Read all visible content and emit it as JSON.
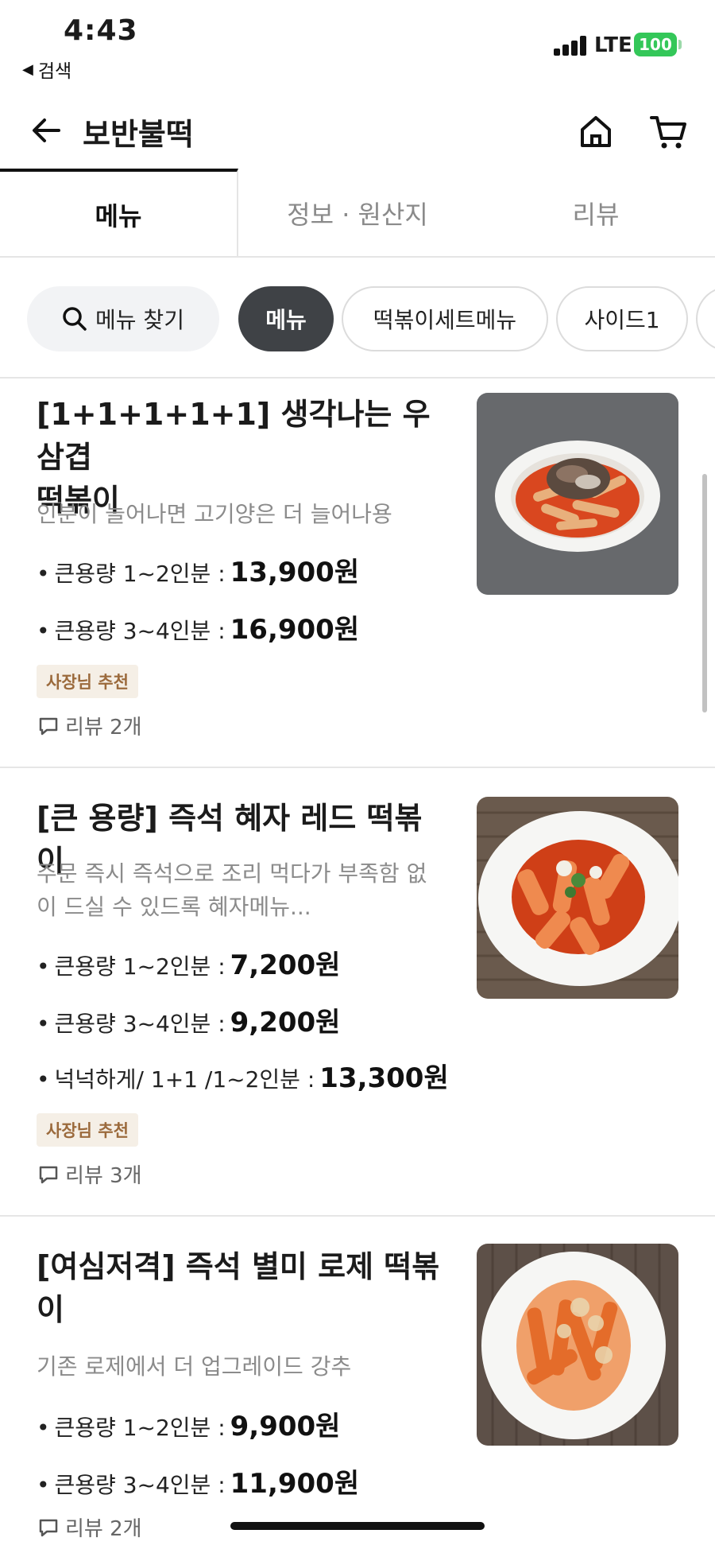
{
  "status_bar": {
    "time": "4:43",
    "back_app": "검색",
    "network": "LTE",
    "battery": "100"
  },
  "header": {
    "title": "보반불떡",
    "back_icon": "arrow-left-icon",
    "home_icon": "home-icon",
    "cart_icon": "cart-icon"
  },
  "tabs": [
    {
      "label": "메뉴",
      "active": true
    },
    {
      "label": "정보 · 원산지",
      "active": false
    },
    {
      "label": "리뷰",
      "active": false
    }
  ],
  "chips": {
    "search_label": "메뉴 찾기",
    "items": [
      "메뉴",
      "떡볶이세트메뉴",
      "사이드1",
      ""
    ]
  },
  "colors": {
    "active_chip": "#3f4246",
    "badge_bg": "#f5efe6",
    "badge_text": "#9b6a3c",
    "battery": "#34c759"
  },
  "menu_items": [
    {
      "name_line1": "[1+1+1+1+1] 생각나는 우삼겹",
      "name_line2": "떡볶이",
      "desc_line1": "인분이 늘어나면 고기양은 더 늘어나용",
      "desc_line2": "",
      "options": [
        {
          "label": "큰용량 1~2인분 :",
          "price": "13,900원"
        },
        {
          "label": "큰용량 3~4인분 :",
          "price": "16,900원"
        }
      ],
      "badge": "사장님 추천",
      "review": "리뷰 2개"
    },
    {
      "name_line1": "[큰 용량] 즉석 혜자 레드 떡볶이",
      "name_line2": "",
      "desc_line1": "주문 즉시 즉석으로 조리 먹다가 부족함 없",
      "desc_line2": "이 드실 수 있드록 혜자메뉴...",
      "options": [
        {
          "label": "큰용량 1~2인분 :",
          "price": "7,200원"
        },
        {
          "label": "큰용량 3~4인분 :",
          "price": "9,200원"
        },
        {
          "label": "넉넉하게/ 1+1 /1~2인분 :",
          "price": "13,300원"
        }
      ],
      "badge": "사장님 추천",
      "review": "리뷰 3개"
    },
    {
      "name_line1": "[여심저격] 즉석 별미 로제 떡볶",
      "name_line2": "이",
      "desc_line1": "기존 로제에서 더 업그레이드 강추",
      "desc_line2": "",
      "options": [
        {
          "label": "큰용량 1~2인분 :",
          "price": "9,900원"
        },
        {
          "label": "큰용량 3~4인분 :",
          "price": "11,900원"
        }
      ],
      "badge": "",
      "review": "리뷰 2개"
    }
  ]
}
